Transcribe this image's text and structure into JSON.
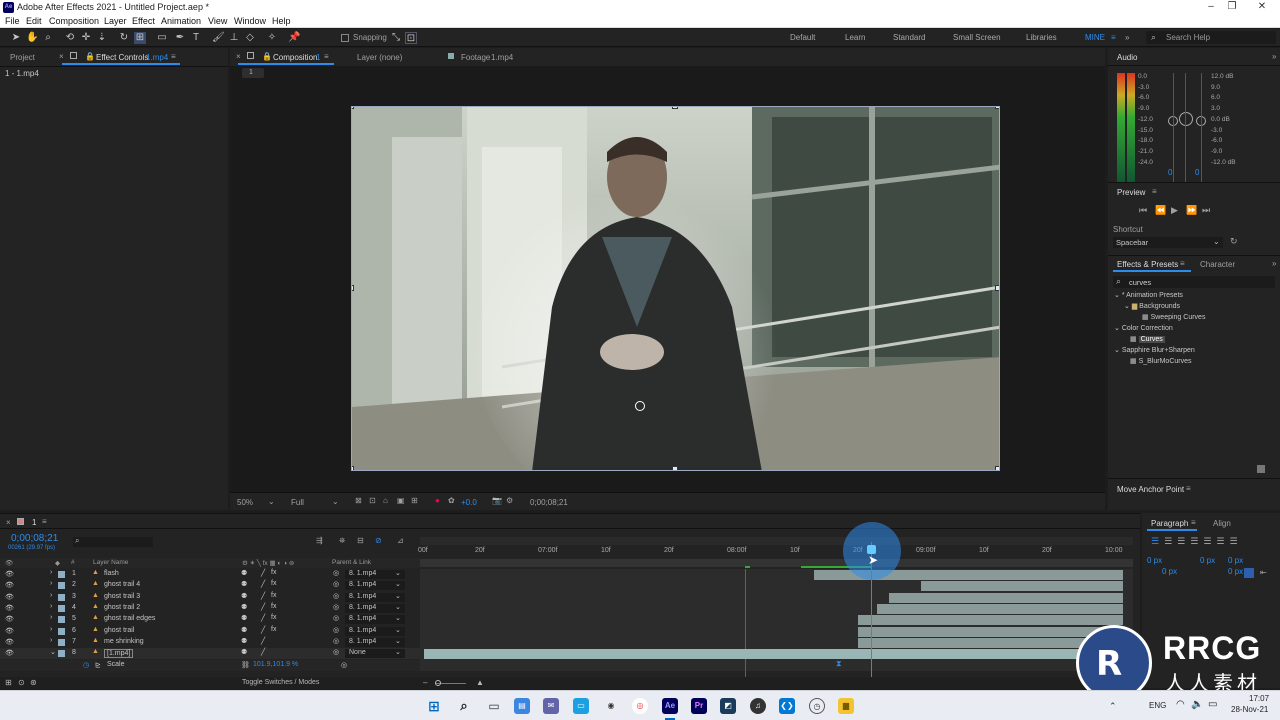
{
  "window": {
    "title": "Adobe After Effects 2021 - Untitled Project.aep *",
    "logo_text": "Ae"
  },
  "menu": [
    "File",
    "Edit",
    "Composition",
    "Layer",
    "Effect",
    "Animation",
    "View",
    "Window",
    "Help"
  ],
  "toolbar": {
    "snapping_label": "Snapping"
  },
  "workspaces": [
    "Default",
    "Learn",
    "Standard",
    "Small Screen",
    "Libraries",
    "MINE"
  ],
  "search_help_placeholder": "Search Help",
  "left_panel": {
    "project_tab": "Project",
    "effect_controls_tab": "Effect Controls",
    "effect_controls_target": "1.mp4",
    "breadcrumb": "1 - 1.mp4"
  },
  "comp_panel": {
    "composition_tab": "Composition",
    "composition_name": "1",
    "layer_tab": "Layer (none)",
    "footage_tab": "Footage",
    "footage_name": "1.mp4",
    "comp_subtab": "1"
  },
  "viewer_footer": {
    "zoom": "50%",
    "resolution": "Full",
    "exposure": "+0.0",
    "timecode": "0;00;08;21"
  },
  "audio": {
    "title": "Audio",
    "left_scale": [
      "0.0",
      "-3.0",
      "-6.0",
      "-9.0",
      "-12.0",
      "-15.0",
      "-18.0",
      "-21.0",
      "-24.0"
    ],
    "right_scale": [
      "12.0 dB",
      "9.0",
      "6.0",
      "3.0",
      "0.0 dB",
      "-3.0",
      "-6.0",
      "-9.0",
      "-12.0 dB"
    ],
    "left_value": "0",
    "right_value": "0"
  },
  "preview": {
    "title": "Preview",
    "shortcut_label": "Shortcut",
    "shortcut_value": "Spacebar"
  },
  "effects_presets": {
    "tab": "Effects & Presets",
    "character_tab": "Character",
    "search_value": "curves",
    "tree": [
      {
        "label": "* Animation Presets",
        "level": 0
      },
      {
        "label": "Backgrounds",
        "level": 1
      },
      {
        "label": "Sweeping Curves",
        "level": 2
      },
      {
        "label": "Color Correction",
        "level": 0
      },
      {
        "label": "Curves",
        "level": 1,
        "selected": true
      },
      {
        "label": "Sapphire Blur+Sharpen",
        "level": 0
      },
      {
        "label": "S_BlurMoCurves",
        "level": 1
      }
    ]
  },
  "move_anchor_point": "Move Anchor Point",
  "timeline": {
    "comp_tab": "1",
    "timecode": "0;00;08;21",
    "timecode_sub": "00261 (29.97 fps)",
    "col_layer_name": "Layer Name",
    "col_parent": "Parent & Link",
    "ruler": [
      "00f",
      "20f",
      "07:00f",
      "10f",
      "20f",
      "08:00f",
      "10f",
      "20f",
      "09:00f",
      "10f",
      "20f",
      "10:00"
    ],
    "layers": [
      {
        "num": "1",
        "name": "flash",
        "parent": "8. 1.mp4"
      },
      {
        "num": "2",
        "name": "ghost trail 4",
        "parent": "8. 1.mp4"
      },
      {
        "num": "3",
        "name": "ghost trail 3",
        "parent": "8. 1.mp4"
      },
      {
        "num": "4",
        "name": "ghost trail 2",
        "parent": "8. 1.mp4"
      },
      {
        "num": "5",
        "name": "ghost trail edges",
        "parent": "8. 1.mp4"
      },
      {
        "num": "6",
        "name": "ghost trail",
        "parent": "8. 1.mp4"
      },
      {
        "num": "7",
        "name": "me shrinking",
        "parent": "8. 1.mp4"
      },
      {
        "num": "8",
        "name": "[1.mp4]",
        "parent": "None"
      }
    ],
    "scale_label": "Scale",
    "scale_value": "101.9,101.9 %",
    "toggle_label": "Toggle Switches / Modes"
  },
  "paragraph": {
    "tab": "Paragraph",
    "align_tab": "Align",
    "px_values": [
      "0 px",
      "0 px",
      "0 px",
      "0 px",
      "0 px"
    ]
  },
  "taskbar": {
    "lang": "ENG",
    "time": "17:07",
    "date": "28-Nov-21"
  },
  "watermark": {
    "brand": "RRCG",
    "sub": "人人素材"
  },
  "colors": {
    "accent": "#2d8ceb",
    "bg": "#232323",
    "track": "#8a9a98"
  }
}
